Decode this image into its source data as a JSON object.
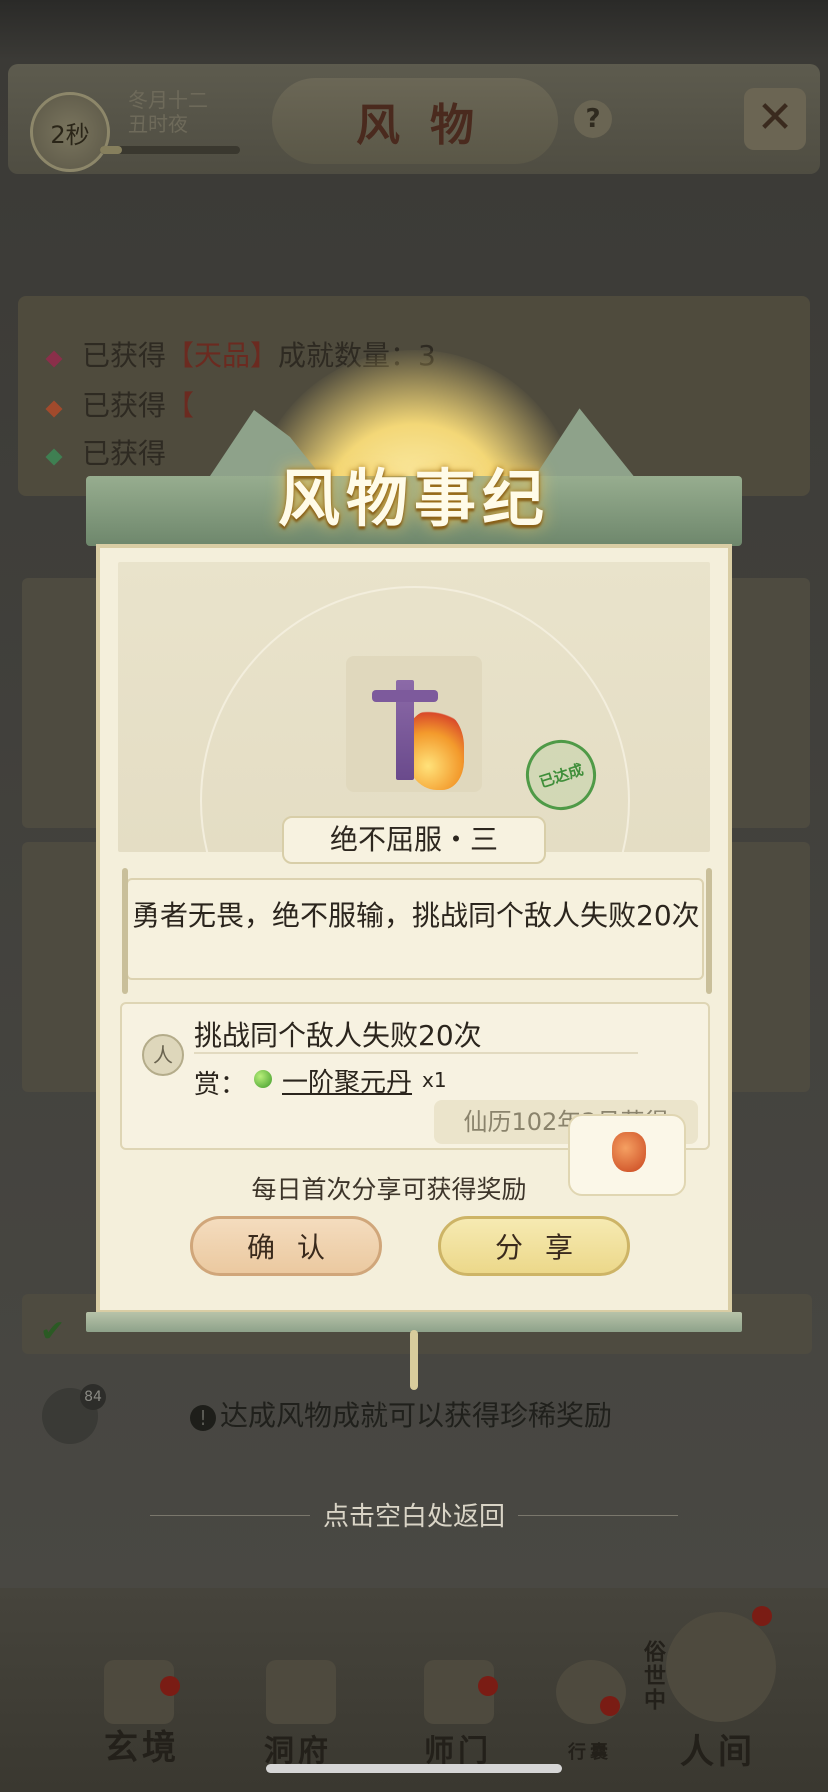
{
  "topbar": {
    "timer": "2秒",
    "date_line1": "冬月十二",
    "date_line2": "丑时夜",
    "title": "风物",
    "help_icon": "?",
    "close_icon": "✕"
  },
  "stats": [
    {
      "prefix": "已获得",
      "highlight": "【天品】",
      "suffix": "成就数量：3",
      "color": "#8a2f4a"
    },
    {
      "prefix": "已获得",
      "highlight": "【",
      "suffix": "",
      "color": "#a14a2c"
    },
    {
      "prefix": "已获得",
      "highlight": "",
      "suffix": "",
      "color": "#3f7f52"
    }
  ],
  "background": {
    "bottom_hint": "达成风物成就可以获得珍稀奖励",
    "chat_badge": "84",
    "return_hint": "点击空白处返回"
  },
  "modal": {
    "banner_title": "风物事纪",
    "achievement_name": "绝不屈服・三",
    "stamp": "已达成",
    "description": "勇者无畏，绝不服输，挑战同个敌人失败20次",
    "requirement_badge": "人",
    "requirement": "挑战同个敌人失败20次",
    "reward_label": "赏：",
    "reward_item": "一阶聚元丹",
    "reward_qty": "x1",
    "obtained_at": "仙历102年3月获得",
    "share_tip": "每日首次分享可获得奖励",
    "confirm_label": "确认",
    "share_label": "分享"
  },
  "tabs": [
    {
      "label": "玄境"
    },
    {
      "label": "洞府"
    },
    {
      "label": "师门"
    },
    {
      "label": "行囊"
    },
    {
      "label": "人间"
    }
  ],
  "side_label": "俗世中"
}
